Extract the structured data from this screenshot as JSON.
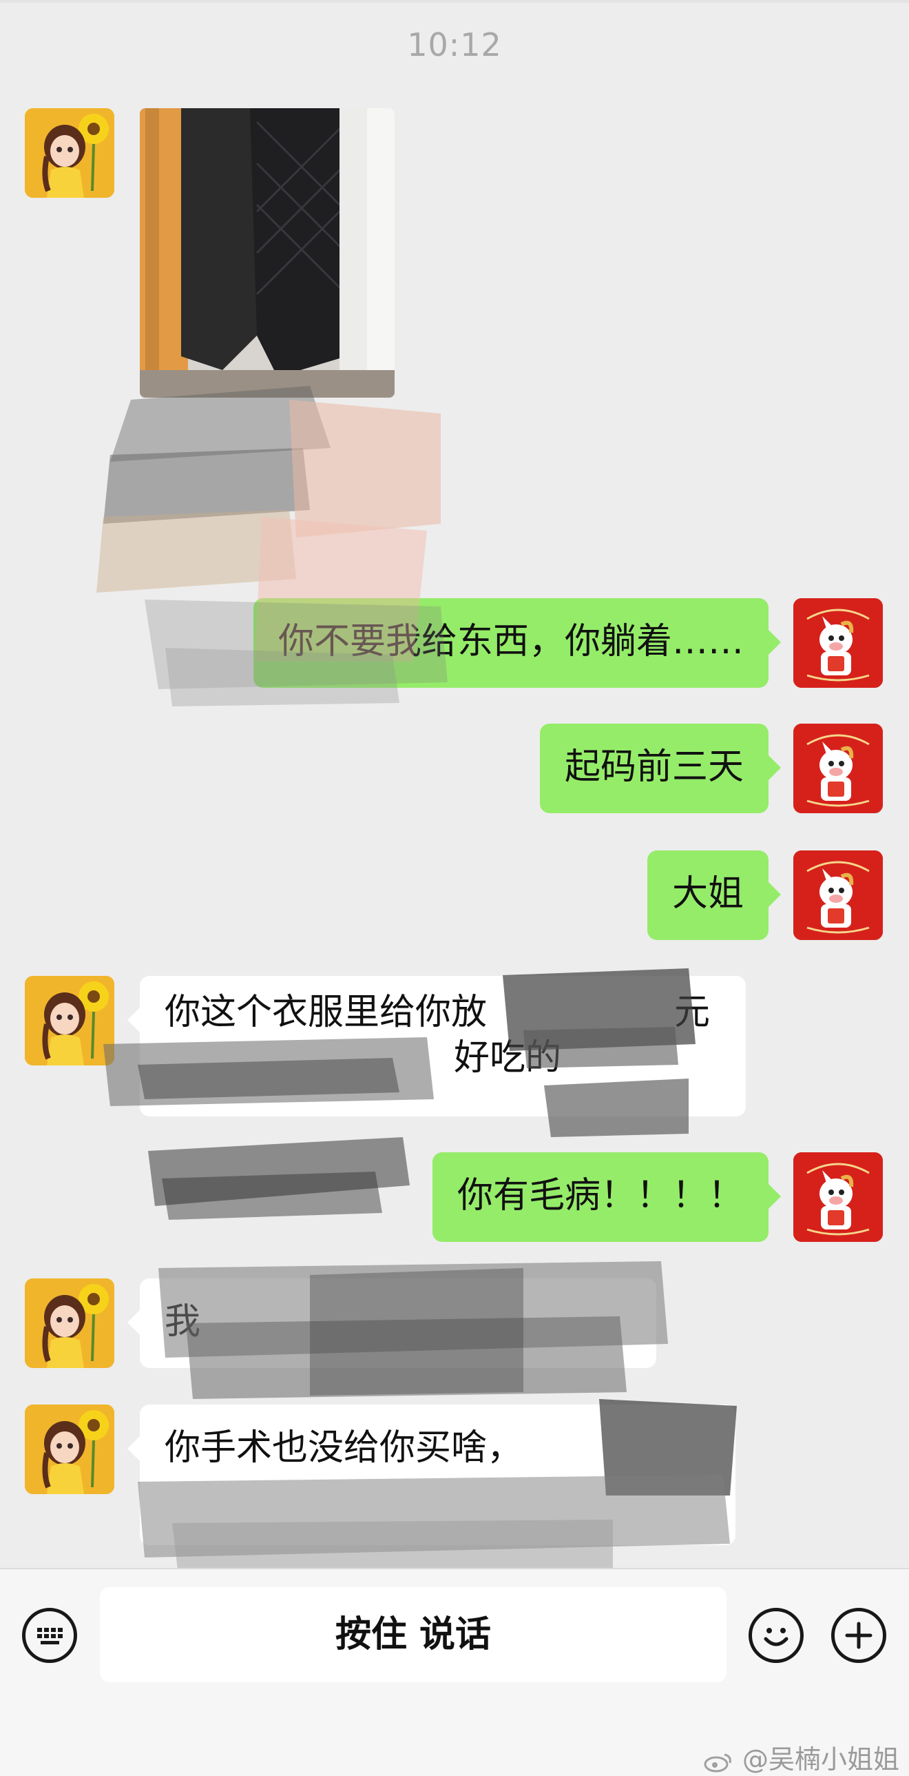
{
  "status": {
    "time": "10:12"
  },
  "messages": {
    "m1_photo": {
      "alt": ""
    },
    "m2": "你不要我给东西，你躺着……",
    "m3": "起码前三天",
    "m4": "大姐",
    "m5_line1": "你这个衣服里给你放",
    "m5_line1_end": "元",
    "m5_line2": "好吃的",
    "m6": "你有毛病！！！！",
    "m7": "我",
    "m8": "你手术也没给你买啥，"
  },
  "input_bar": {
    "hold_to_talk": "按住 说话",
    "keyboard_icon": "keyboard-icon",
    "emoji_icon": "emoji-icon",
    "plus_icon": "plus-icon"
  },
  "watermark": "@吴楠小姐姐",
  "colors": {
    "background": "#ededed",
    "outgoing_bubble": "#95ec69",
    "incoming_bubble": "#ffffff",
    "timestamp": "#a8a8a8"
  }
}
